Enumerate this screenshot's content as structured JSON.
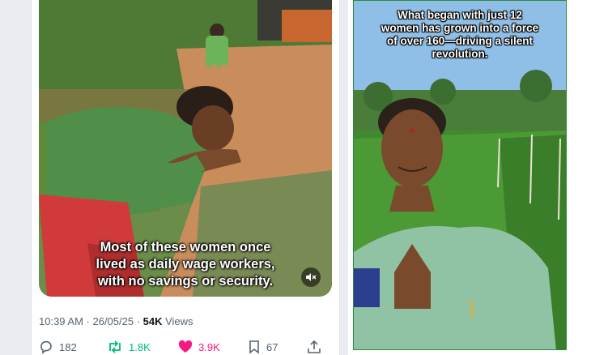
{
  "left_post": {
    "video": {
      "caption_lines": [
        "Most of these women once",
        "lived as daily wage workers,",
        "with no savings or security."
      ],
      "mute_icon": "speaker-muted-icon"
    },
    "timestamp": "10:39 AM · 26/05/25 · ",
    "views_count": "54K",
    "views_label": " Views",
    "actions": {
      "replies": "182",
      "reposts": "1.8K",
      "likes": "3.9K",
      "bookmarks": "67"
    },
    "colors": {
      "repost": "#00ba7c",
      "like": "#f91880",
      "muted": "#536471"
    }
  },
  "right_post": {
    "headline_lines": [
      "What began with just 12",
      "women has grown into a force",
      "of over 160—driving a silent",
      "revolution."
    ],
    "border_color": "#2a8a3a"
  }
}
